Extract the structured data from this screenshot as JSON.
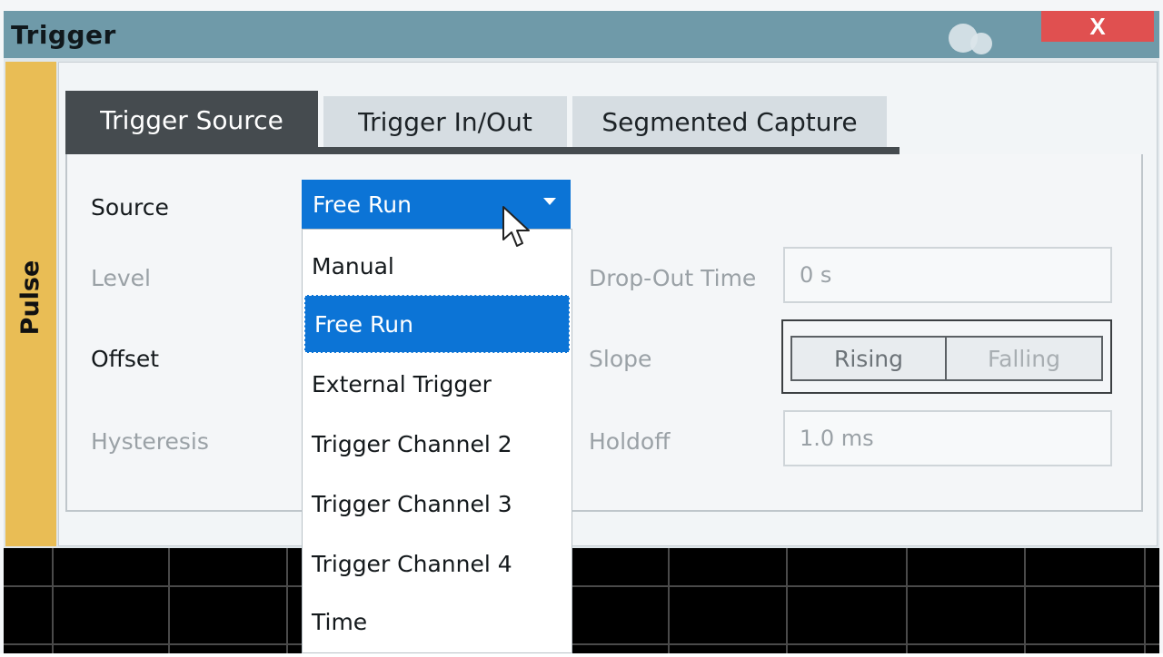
{
  "window": {
    "title": "Trigger",
    "close_label": "X"
  },
  "side_tab": {
    "label": "Pulse"
  },
  "tabs": [
    {
      "label": "Trigger Source",
      "active": true
    },
    {
      "label": "Trigger In/Out",
      "active": false
    },
    {
      "label": "Segmented Capture",
      "active": false
    }
  ],
  "form": {
    "source_label": "Source",
    "level_label": "Level",
    "offset_label": "Offset",
    "hysteresis_label": "Hysteresis",
    "dropout_label": "Drop-Out Time",
    "dropout_value": "0 s",
    "slope_label": "Slope",
    "slope_rising": "Rising",
    "slope_falling": "Falling",
    "holdoff_label": "Holdoff",
    "holdoff_value": "1.0 ms"
  },
  "dropdown": {
    "selected": "Free Run",
    "options": [
      "Manual",
      "Free Run",
      "External Trigger",
      "Trigger Channel 2",
      "Trigger Channel 3",
      "Trigger Channel 4",
      "Time"
    ]
  },
  "colors": {
    "accent": "#0c74d6",
    "titlebar": "#6f9aa9",
    "side_tab": "#e9bd55",
    "close": "#e05050"
  }
}
